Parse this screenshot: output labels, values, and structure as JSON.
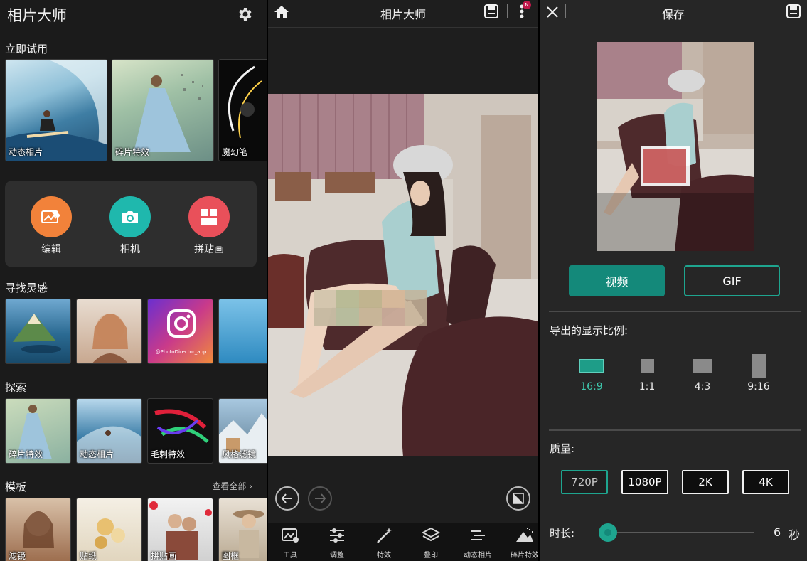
{
  "home": {
    "title": "相片大师",
    "try_now": {
      "label": "立即试用",
      "items": [
        {
          "label": "动态相片"
        },
        {
          "label": "碎片特效"
        },
        {
          "label": "魔幻笔"
        }
      ]
    },
    "quick_actions": [
      {
        "label": "编辑",
        "icon": "edit-photo-icon",
        "color": "#f2823a"
      },
      {
        "label": "相机",
        "icon": "camera-icon",
        "color": "#1fb8ad"
      },
      {
        "label": "拼贴画",
        "icon": "collage-icon",
        "color": "#e9505a"
      }
    ],
    "inspiration": {
      "label": "寻找灵感",
      "instagram_handle": "@PhotoDirector_app"
    },
    "explore": {
      "label": "探索",
      "items": [
        {
          "label": "碎片特效"
        },
        {
          "label": "动态相片"
        },
        {
          "label": "毛刺特效"
        },
        {
          "label": "风格滤镜"
        }
      ]
    },
    "templates": {
      "label": "模板",
      "see_all": "查看全部",
      "items": [
        {
          "label": "滤镜"
        },
        {
          "label": "贴纸"
        },
        {
          "label": "拼贴画"
        },
        {
          "label": "图框"
        }
      ]
    }
  },
  "editor": {
    "title": "相片大师",
    "notification_badge": "N",
    "tools": [
      {
        "label": "工具",
        "icon": "tools-icon"
      },
      {
        "label": "调整",
        "icon": "adjust-sliders-icon"
      },
      {
        "label": "特效",
        "icon": "magic-wand-icon"
      },
      {
        "label": "叠印",
        "icon": "layers-icon"
      },
      {
        "label": "动态相片",
        "icon": "animation-icon"
      },
      {
        "label": "碎片特效",
        "icon": "dispersion-icon"
      }
    ]
  },
  "save": {
    "title": "保存",
    "video_label": "视频",
    "gif_label": "GIF",
    "ratio_label": "导出的显示比例:",
    "ratios": [
      {
        "label": "16:9",
        "selected": true
      },
      {
        "label": "1:1",
        "selected": false
      },
      {
        "label": "4:3",
        "selected": false
      },
      {
        "label": "9:16",
        "selected": false
      }
    ],
    "quality_label": "质量:",
    "qualities": [
      {
        "label": "720P",
        "selected": true
      },
      {
        "label": "1080P",
        "selected": false
      },
      {
        "label": "2K",
        "selected": false
      },
      {
        "label": "4K",
        "selected": false
      }
    ],
    "duration_label": "时长:",
    "duration_value": "6",
    "duration_unit": "秒",
    "duration_fraction": 0.0
  },
  "colors": {
    "accent": "#1ea58f",
    "accent_dark": "#14897a"
  }
}
